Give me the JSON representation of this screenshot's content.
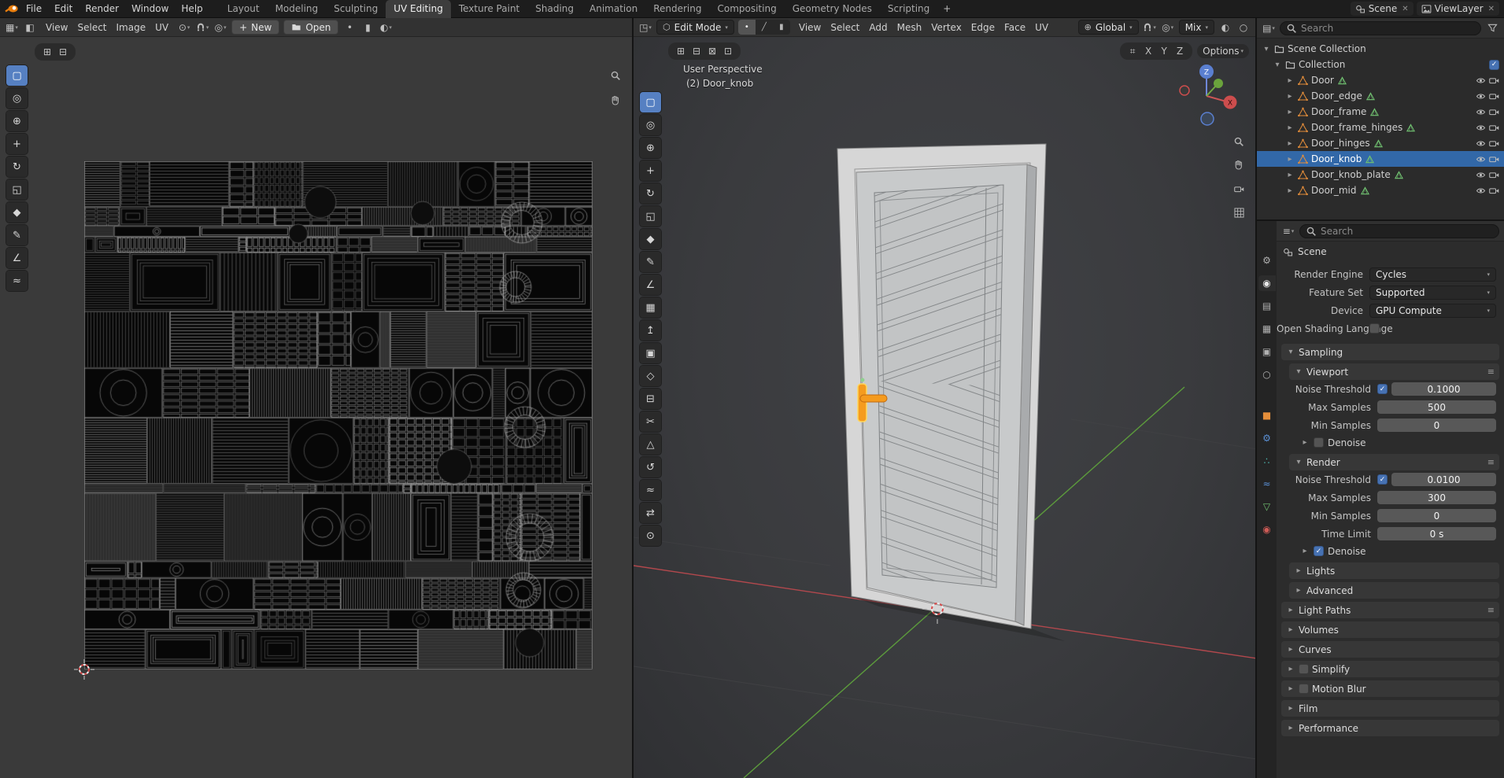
{
  "topbar": {
    "menus": [
      "File",
      "Edit",
      "Render",
      "Window",
      "Help"
    ],
    "workspaces": [
      "Layout",
      "Modeling",
      "Sculpting",
      "UV Editing",
      "Texture Paint",
      "Shading",
      "Animation",
      "Rendering",
      "Compositing",
      "Geometry Nodes",
      "Scripting"
    ],
    "active_workspace": "UV Editing",
    "add_workspace": "+",
    "scene": {
      "label": "Scene"
    },
    "viewlayer": {
      "label": "ViewLayer"
    }
  },
  "uv_editor": {
    "menus": [
      "View",
      "Select",
      "Image",
      "UV"
    ],
    "new_button": "New",
    "open_button": "Open",
    "tools": [
      {
        "name": "tweak",
        "glyph": "▢",
        "active": true
      },
      {
        "name": "select-circle",
        "glyph": "◎"
      },
      {
        "name": "cursor",
        "glyph": "⊕"
      },
      {
        "name": "move",
        "glyph": "+"
      },
      {
        "name": "rotate",
        "glyph": "↻"
      },
      {
        "name": "scale",
        "glyph": "◱"
      },
      {
        "name": "transform",
        "glyph": "◆"
      },
      {
        "name": "annotate",
        "glyph": "✎"
      },
      {
        "name": "measure",
        "glyph": "∠"
      },
      {
        "name": "grab",
        "glyph": "≈"
      }
    ]
  },
  "viewport": {
    "mode": "Edit Mode",
    "menus": [
      "View",
      "Select",
      "Add",
      "Mesh",
      "Vertex",
      "Edge",
      "Face",
      "UV"
    ],
    "orientation": "Global",
    "mix_label": "Mix",
    "options_label": "Options",
    "axis_x": "X",
    "axis_y": "Y",
    "axis_z": "Z",
    "overlay": {
      "perspective": "User Perspective",
      "active_object": "(2) Door_knob"
    },
    "gizmo": {
      "x": "X",
      "z": "Z"
    },
    "tools": [
      {
        "name": "tweak",
        "glyph": "▢",
        "active": true
      },
      {
        "name": "select-circle",
        "glyph": "◎"
      },
      {
        "name": "cursor",
        "glyph": "⊕"
      },
      {
        "name": "move",
        "glyph": "+"
      },
      {
        "name": "rotate",
        "glyph": "↻"
      },
      {
        "name": "scale",
        "glyph": "◱"
      },
      {
        "name": "transform",
        "glyph": "◆"
      },
      {
        "name": "annotate",
        "glyph": "✎"
      },
      {
        "name": "measure",
        "glyph": "∠"
      },
      {
        "name": "add-cube",
        "glyph": "▦"
      },
      {
        "name": "extrude",
        "glyph": "↥"
      },
      {
        "name": "inset",
        "glyph": "▣"
      },
      {
        "name": "bevel",
        "glyph": "◇"
      },
      {
        "name": "loop-cut",
        "glyph": "⊟"
      },
      {
        "name": "knife",
        "glyph": "✂"
      },
      {
        "name": "poly-build",
        "glyph": "△"
      },
      {
        "name": "spin",
        "glyph": "↺"
      },
      {
        "name": "smooth",
        "glyph": "≈"
      },
      {
        "name": "edge-slide",
        "glyph": "⇄"
      },
      {
        "name": "shrink-fatten",
        "glyph": "⊙"
      }
    ]
  },
  "outliner": {
    "search_placeholder": "Search",
    "scene_collection": "Scene Collection",
    "collection": "Collection",
    "items": [
      {
        "label": "Door"
      },
      {
        "label": "Door_edge"
      },
      {
        "label": "Door_frame"
      },
      {
        "label": "Door_frame_hinges"
      },
      {
        "label": "Door_hinges"
      },
      {
        "label": "Door_knob",
        "selected": true
      },
      {
        "label": "Door_knob_plate"
      },
      {
        "label": "Door_mid"
      }
    ]
  },
  "properties": {
    "search_placeholder": "Search",
    "context": "Scene",
    "render_engine_label": "Render Engine",
    "render_engine_value": "Cycles",
    "feature_set_label": "Feature Set",
    "feature_set_value": "Supported",
    "device_label": "Device",
    "device_value": "GPU Compute",
    "osl_label": "Open Shading Language",
    "sampling_title": "Sampling",
    "viewport_panel": {
      "title": "Viewport",
      "noise_threshold_label": "Noise Threshold",
      "noise_threshold_value": "0.1000",
      "max_samples_label": "Max Samples",
      "max_samples_value": "500",
      "min_samples_label": "Min Samples",
      "min_samples_value": "0",
      "denoise_label": "Denoise"
    },
    "render_panel": {
      "title": "Render",
      "noise_threshold_label": "Noise Threshold",
      "noise_threshold_value": "0.0100",
      "max_samples_label": "Max Samples",
      "max_samples_value": "300",
      "min_samples_label": "Min Samples",
      "min_samples_value": "0",
      "time_limit_label": "Time Limit",
      "time_limit_value": "0 s",
      "denoise_label": "Denoise"
    },
    "lights_label": "Lights",
    "advanced_label": "Advanced",
    "sections": [
      {
        "label": "Light Paths",
        "menu": true
      },
      {
        "label": "Volumes"
      },
      {
        "label": "Curves"
      },
      {
        "label": "Simplify",
        "checkbox": true
      },
      {
        "label": "Motion Blur",
        "checkbox": true
      },
      {
        "label": "Film"
      },
      {
        "label": "Performance"
      }
    ],
    "tabs": [
      {
        "name": "tool",
        "glyph": "⚙"
      },
      {
        "name": "render",
        "glyph": "◉",
        "active": true
      },
      {
        "name": "output",
        "glyph": "▤"
      },
      {
        "name": "view-layer",
        "glyph": "▦"
      },
      {
        "name": "scene",
        "glyph": "▣"
      },
      {
        "name": "world",
        "glyph": "○"
      },
      {
        "gap": true
      },
      {
        "name": "object",
        "glyph": "■",
        "color": "#e58e3a"
      },
      {
        "name": "modifiers",
        "glyph": "⚙",
        "color": "#5a8fd4"
      },
      {
        "name": "particles",
        "glyph": "∴",
        "color": "#4fb8b0"
      },
      {
        "name": "physics",
        "glyph": "≈",
        "color": "#5a8fd4"
      },
      {
        "name": "data",
        "glyph": "▽",
        "color": "#71c171"
      },
      {
        "name": "material",
        "glyph": "◉",
        "color": "#cf5b56"
      }
    ]
  },
  "colors": {
    "accent_blue": "#4772b3",
    "selection_highlight": "#3268a8",
    "active_tool_blue": "#5680c2",
    "knob_selection_orange": "#f59b1e",
    "object_icon_orange": "#e58e3a",
    "mesh_icon_green": "#71c171",
    "axis_red": "#b2484d",
    "axis_green": "#5c9b3c"
  }
}
